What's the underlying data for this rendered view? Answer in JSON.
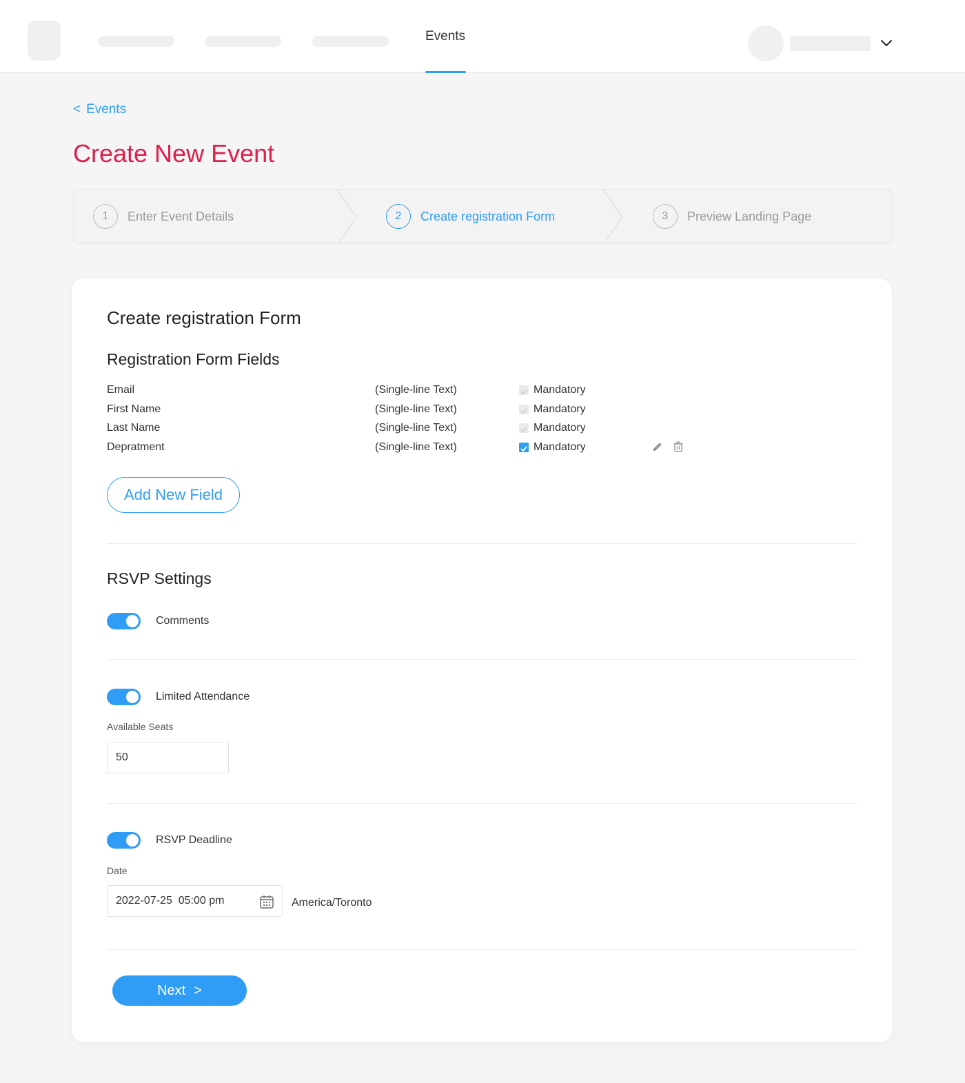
{
  "nav": {
    "active_item": "Events"
  },
  "breadcrumb": {
    "back_symbol": "<",
    "label": "Events"
  },
  "page": {
    "title": "Create New Event"
  },
  "stepper": {
    "steps": [
      {
        "number": "1",
        "label": "Enter Event Details",
        "state": "inactive"
      },
      {
        "number": "2",
        "label": "Create registration Form",
        "state": "active"
      },
      {
        "number": "3",
        "label": "Preview Landing Page",
        "state": "inactive"
      }
    ]
  },
  "form": {
    "heading": "Create registration Form",
    "fields_heading": "Registration Form Fields",
    "fields": [
      {
        "name": "Email",
        "type": "(Single-line Text)",
        "mandatory_label": "Mandatory",
        "mandatory": true,
        "editable": false
      },
      {
        "name": "First Name",
        "type": "(Single-line Text)",
        "mandatory_label": "Mandatory",
        "mandatory": true,
        "editable": false
      },
      {
        "name": "Last Name",
        "type": "(Single-line Text)",
        "mandatory_label": "Mandatory",
        "mandatory": true,
        "editable": false
      },
      {
        "name": "Depratment",
        "type": "(Single-line Text)",
        "mandatory_label": "Mandatory",
        "mandatory": true,
        "editable": true
      }
    ],
    "add_field_label": "Add New Field"
  },
  "rsvp": {
    "heading": "RSVP Settings",
    "comments": {
      "label": "Comments",
      "enabled": true
    },
    "limited_attendance": {
      "label": "Limited Attendance",
      "enabled": true,
      "seats_label": "Available Seats",
      "seats_value": "50"
    },
    "deadline": {
      "label": "RSVP Deadline",
      "enabled": true,
      "date_label": "Date",
      "date_value": "2022-07-25  05:00 pm",
      "timezone": "America/Toronto"
    }
  },
  "actions": {
    "next_label": "Next",
    "next_symbol": ">"
  },
  "colors": {
    "accent": "#2f9df5",
    "title": "#dc1f4b"
  }
}
